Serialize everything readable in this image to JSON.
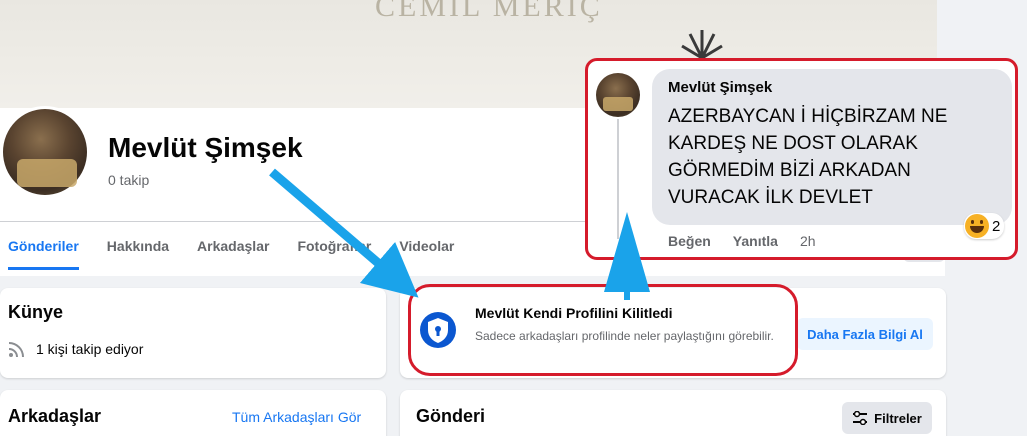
{
  "cover": {
    "title": "CEMİL MERİÇ"
  },
  "profile": {
    "name": "Mevlüt Şimşek",
    "followers": "0 takip"
  },
  "tabs": [
    {
      "label": "Gönderiler",
      "active": true
    },
    {
      "label": "Hakkında"
    },
    {
      "label": "Arkadaşlar"
    },
    {
      "label": "Fotoğraflar"
    },
    {
      "label": "Videolar"
    }
  ],
  "intro": {
    "title": "Künye",
    "following": "1 kişi takip ediyor"
  },
  "lock_notice": {
    "title": "Mevlüt Kendi Profilini Kilitledi",
    "description": "Sadece arkadaşları profilinde neler paylaştığını görebilir.",
    "button": "Daha Fazla Bilgi Al"
  },
  "friends": {
    "title": "Arkadaşlar",
    "see_all": "Tüm Arkadaşları Gör"
  },
  "posts": {
    "title": "Gönderi",
    "filter": "Filtreler"
  },
  "comment": {
    "author": "Mevlüt Şimşek",
    "text": "AZERBAYCAN İ HİÇBİRZAM NE KARDEŞ NE DOST OLARAK GÖRMEDİM BİZİ ARKADAN VURACAK İLK DEVLET",
    "like": "Beğen",
    "reply": "Yanıtla",
    "time": "2h",
    "reaction_count": "2"
  },
  "colors": {
    "accent": "#1877f2",
    "highlight": "#d51b2b",
    "arrow": "#1aa3ea"
  }
}
